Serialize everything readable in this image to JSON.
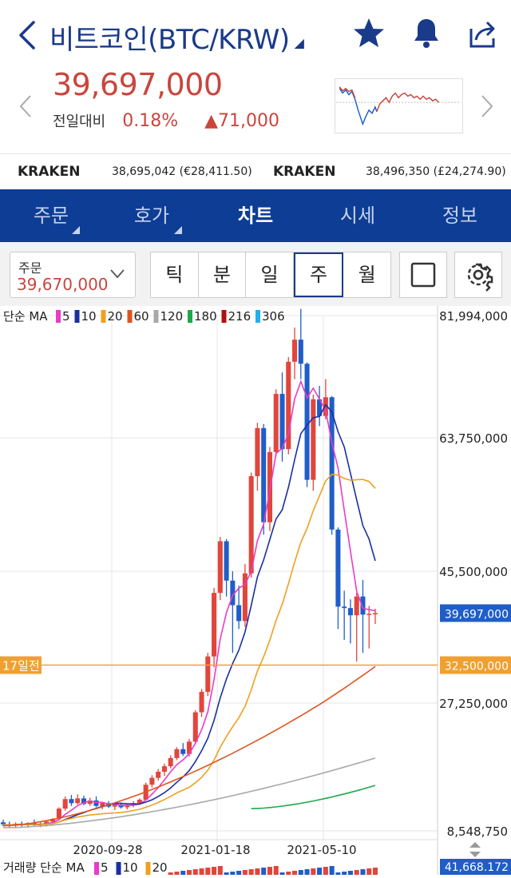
{
  "header": {
    "title": "비트코인(BTC/KRW)",
    "price": "39,697,000",
    "change_label": "전일대비",
    "change_pct": "0.18%",
    "change_amount": "▲71,000"
  },
  "exchanges": [
    {
      "name": "KRAKEN",
      "value": "38,695,042 (€28,411.50)"
    },
    {
      "name": "KRAKEN",
      "value": "38,496,350 (£24,274.90)"
    }
  ],
  "tabs": [
    "주문",
    "호가",
    "차트",
    "시세",
    "정보"
  ],
  "active_tab": "차트",
  "order": {
    "label": "주문",
    "value": "39,670,000"
  },
  "periods": [
    "틱",
    "분",
    "일",
    "주",
    "월"
  ],
  "active_period": "주",
  "colors": {
    "up": "#e0463c",
    "down": "#1f5ec9",
    "brand": "#0d3d94",
    "price_red": "#c9463d",
    "marker": "#f0a030"
  },
  "chart_data": {
    "type": "candlestick",
    "ma_legend": {
      "label": "단순 MA",
      "items": [
        {
          "period": "5",
          "color": "#e83cc8"
        },
        {
          "period": "10",
          "color": "#1a2fa0"
        },
        {
          "period": "20",
          "color": "#f0a020"
        },
        {
          "period": "60",
          "color": "#e0541c"
        },
        {
          "period": "120",
          "color": "#a8a8a8"
        },
        {
          "period": "180",
          "color": "#1ea84a"
        },
        {
          "period": "216",
          "color": "#b01010"
        },
        {
          "period": "306",
          "color": "#20b0f0"
        }
      ]
    },
    "y_ticks": [
      "81,994,000",
      "63,750,000",
      "45,500,000",
      "27,250,000",
      "8,548,750"
    ],
    "y_tick_values": [
      81994000,
      63750000,
      45500000,
      27250000,
      8548750
    ],
    "ylim": [
      8548750,
      81994000
    ],
    "x_ticks": [
      "2020-09-28",
      "2021-01-18",
      "2021-05-10"
    ],
    "current_price_label": "39,697,000",
    "current_price": 39697000,
    "reference_line": {
      "label": "17일전",
      "value_label": "32,500,000",
      "value": 32500000
    },
    "candles": [
      {
        "o": 9.8,
        "h": 10.2,
        "l": 9.2,
        "c": 9.5
      },
      {
        "o": 9.5,
        "h": 9.9,
        "l": 9.1,
        "c": 9.3
      },
      {
        "o": 9.3,
        "h": 9.8,
        "l": 9.0,
        "c": 9.6
      },
      {
        "o": 9.6,
        "h": 9.9,
        "l": 9.2,
        "c": 9.4
      },
      {
        "o": 9.4,
        "h": 9.8,
        "l": 9.0,
        "c": 9.7
      },
      {
        "o": 9.7,
        "h": 10.2,
        "l": 9.3,
        "c": 9.4
      },
      {
        "o": 9.4,
        "h": 9.8,
        "l": 9.1,
        "c": 9.6
      },
      {
        "o": 9.6,
        "h": 10.0,
        "l": 9.2,
        "c": 9.9
      },
      {
        "o": 9.9,
        "h": 10.4,
        "l": 9.5,
        "c": 10.3
      },
      {
        "o": 10.3,
        "h": 12.0,
        "l": 10.1,
        "c": 11.8
      },
      {
        "o": 11.8,
        "h": 13.6,
        "l": 11.5,
        "c": 13.2
      },
      {
        "o": 13.2,
        "h": 13.8,
        "l": 12.2,
        "c": 12.6
      },
      {
        "o": 12.6,
        "h": 13.9,
        "l": 12.4,
        "c": 13.3
      },
      {
        "o": 13.3,
        "h": 13.7,
        "l": 12.3,
        "c": 12.5
      },
      {
        "o": 12.5,
        "h": 13.4,
        "l": 12.2,
        "c": 13.0
      },
      {
        "o": 13.0,
        "h": 13.6,
        "l": 12.0,
        "c": 12.2
      },
      {
        "o": 12.2,
        "h": 12.8,
        "l": 11.7,
        "c": 12.6
      },
      {
        "o": 12.6,
        "h": 12.9,
        "l": 11.9,
        "c": 12.1
      },
      {
        "o": 12.1,
        "h": 12.6,
        "l": 11.6,
        "c": 12.4
      },
      {
        "o": 12.4,
        "h": 12.7,
        "l": 11.8,
        "c": 12.0
      },
      {
        "o": 12.0,
        "h": 12.5,
        "l": 11.7,
        "c": 12.3
      },
      {
        "o": 12.3,
        "h": 12.9,
        "l": 12.0,
        "c": 12.6
      },
      {
        "o": 12.6,
        "h": 13.3,
        "l": 12.4,
        "c": 13.1
      },
      {
        "o": 13.1,
        "h": 15.6,
        "l": 13.0,
        "c": 15.3
      },
      {
        "o": 15.3,
        "h": 16.7,
        "l": 14.9,
        "c": 16.3
      },
      {
        "o": 16.3,
        "h": 17.6,
        "l": 15.9,
        "c": 17.2
      },
      {
        "o": 17.2,
        "h": 18.4,
        "l": 16.6,
        "c": 18.0
      },
      {
        "o": 18.0,
        "h": 19.6,
        "l": 17.7,
        "c": 19.2
      },
      {
        "o": 19.2,
        "h": 20.8,
        "l": 18.9,
        "c": 20.5
      },
      {
        "o": 20.5,
        "h": 21.4,
        "l": 19.5,
        "c": 19.8
      },
      {
        "o": 19.8,
        "h": 22.0,
        "l": 19.4,
        "c": 21.6
      },
      {
        "o": 21.6,
        "h": 26.2,
        "l": 21.2,
        "c": 25.9
      },
      {
        "o": 25.9,
        "h": 29.2,
        "l": 25.2,
        "c": 28.8
      },
      {
        "o": 28.8,
        "h": 34.2,
        "l": 28.2,
        "c": 33.7
      },
      {
        "o": 33.7,
        "h": 43.2,
        "l": 32.2,
        "c": 42.5
      },
      {
        "o": 42.5,
        "h": 50.2,
        "l": 41.5,
        "c": 49.6
      },
      {
        "o": 49.6,
        "h": 49.9,
        "l": 42.0,
        "c": 44.2
      },
      {
        "o": 44.2,
        "h": 45.5,
        "l": 34.2,
        "c": 40.8
      },
      {
        "o": 40.8,
        "h": 43.5,
        "l": 37.5,
        "c": 38.6
      },
      {
        "o": 38.6,
        "h": 46.5,
        "l": 37.8,
        "c": 45.2
      },
      {
        "o": 45.2,
        "h": 59.0,
        "l": 44.6,
        "c": 58.5
      },
      {
        "o": 58.5,
        "h": 66.0,
        "l": 56.5,
        "c": 65.2
      },
      {
        "o": 65.2,
        "h": 65.8,
        "l": 50.5,
        "c": 52.2
      },
      {
        "o": 52.2,
        "h": 62.5,
        "l": 51.0,
        "c": 61.8
      },
      {
        "o": 61.8,
        "h": 71.0,
        "l": 61.2,
        "c": 70.3
      },
      {
        "o": 70.3,
        "h": 73.5,
        "l": 60.5,
        "c": 62.2
      },
      {
        "o": 62.2,
        "h": 75.8,
        "l": 61.5,
        "c": 75.1
      },
      {
        "o": 75.1,
        "h": 80.2,
        "l": 72.5,
        "c": 78.4
      },
      {
        "o": 78.4,
        "h": 83.0,
        "l": 72.5,
        "c": 74.8
      },
      {
        "o": 74.8,
        "h": 75.0,
        "l": 57.0,
        "c": 58.0
      },
      {
        "o": 58.0,
        "h": 70.2,
        "l": 56.5,
        "c": 69.5
      },
      {
        "o": 69.5,
        "h": 71.5,
        "l": 65.5,
        "c": 67.0
      },
      {
        "o": 67.0,
        "h": 72.5,
        "l": 66.5,
        "c": 69.8
      },
      {
        "o": 69.8,
        "h": 70.0,
        "l": 50.5,
        "c": 51.2
      },
      {
        "o": 51.2,
        "h": 51.5,
        "l": 37.5,
        "c": 40.6
      },
      {
        "o": 40.6,
        "h": 42.8,
        "l": 36.0,
        "c": 40.4
      },
      {
        "o": 40.4,
        "h": 41.6,
        "l": 35.5,
        "c": 39.4
      },
      {
        "o": 39.4,
        "h": 42.5,
        "l": 33.0,
        "c": 42.0
      },
      {
        "o": 42.0,
        "h": 44.3,
        "l": 34.2,
        "c": 39.5
      },
      {
        "o": 39.5,
        "h": 40.7,
        "l": 34.8,
        "c": 39.6
      },
      {
        "o": 39.6,
        "h": 40.3,
        "l": 38.2,
        "c": 39.7
      }
    ],
    "candle_unit": "millions KRW",
    "volume": {
      "label": "거래량 단순 MA",
      "periods": [
        "5",
        "10",
        "20"
      ],
      "max_label": "41,668.172"
    }
  }
}
